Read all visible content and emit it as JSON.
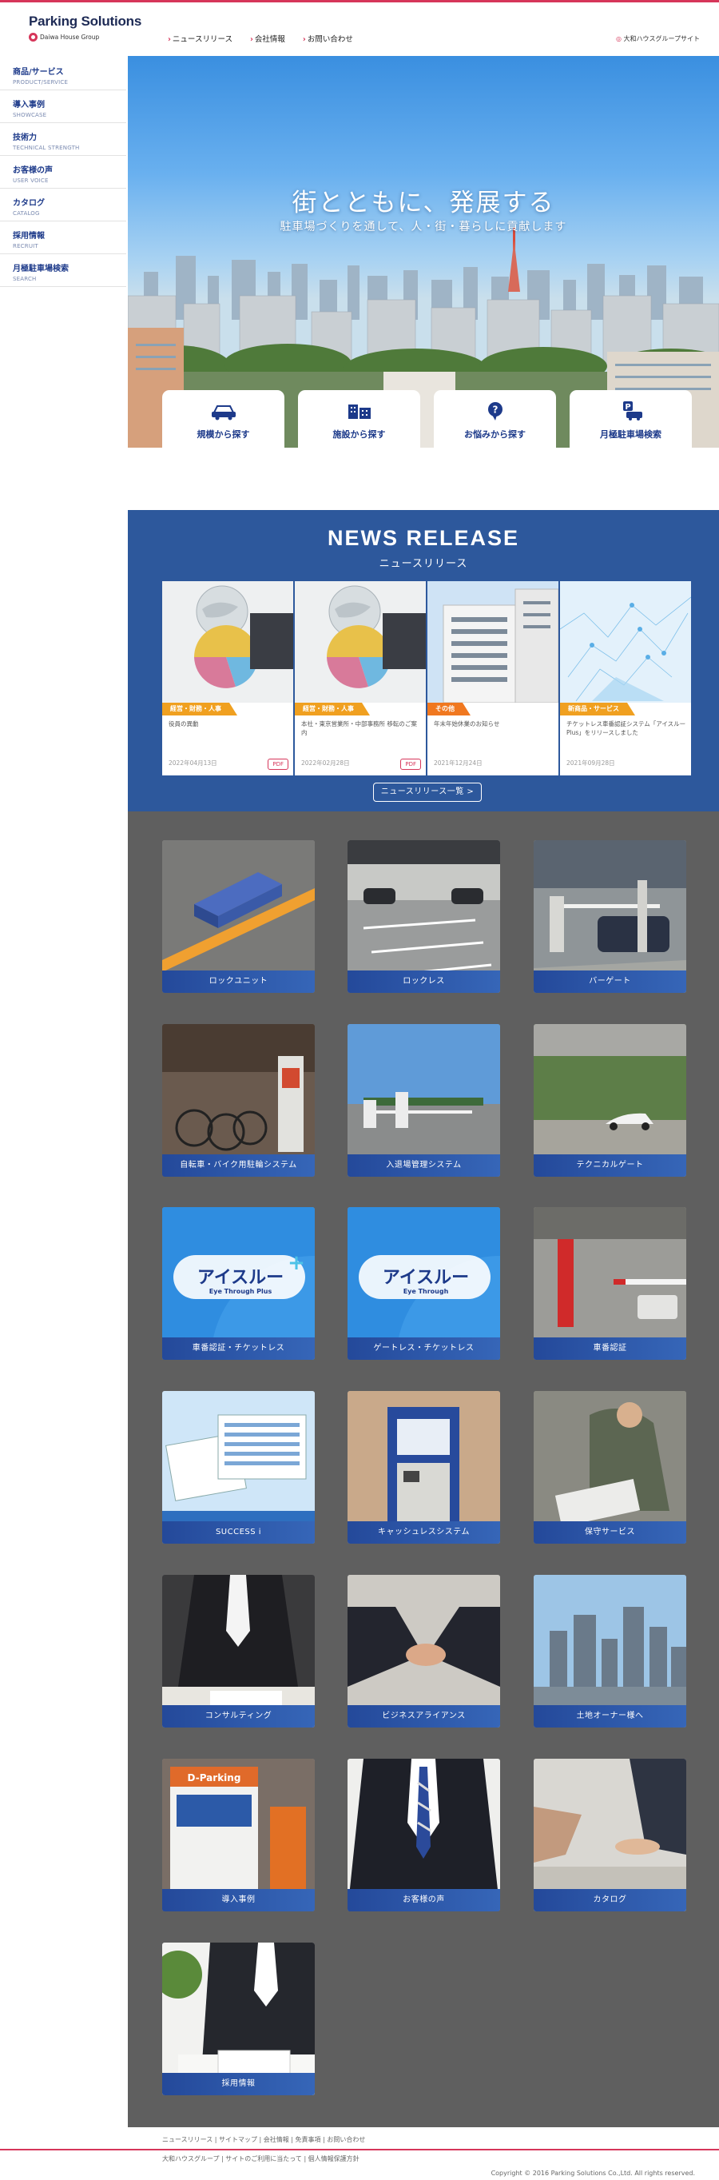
{
  "header": {
    "logo_title": "Parking Solutions",
    "logo_group": "Daiwa House Group",
    "nav": [
      "ニュースリリース",
      "会社情報",
      "お問い合わせ"
    ],
    "group_link": "大和ハウスグループサイト"
  },
  "sidebar": {
    "items": [
      {
        "jp": "商品/サービス",
        "en": "PRODUCT/SERVICE"
      },
      {
        "jp": "導入事例",
        "en": "SHOWCASE"
      },
      {
        "jp": "技術力",
        "en": "TECHNICAL STRENGTH"
      },
      {
        "jp": "お客様の声",
        "en": "USER VOICE"
      },
      {
        "jp": "カタログ",
        "en": "CATALOG"
      },
      {
        "jp": "採用情報",
        "en": "RECRUIT"
      },
      {
        "jp": "月極駐車場検索",
        "en": "SEARCH"
      }
    ]
  },
  "hero": {
    "title": "街とともに、発展する",
    "subtitle": "駐車場づくりを通して、人・街・暮らしに貢献します",
    "search_buttons": [
      {
        "label": "規模から探す",
        "icon": "car-icon"
      },
      {
        "label": "施設から探す",
        "icon": "building-icon"
      },
      {
        "label": "お悩みから探す",
        "icon": "question-bubble-icon"
      },
      {
        "label": "月極駐車場検索",
        "icon": "parking-car-icon"
      }
    ]
  },
  "news": {
    "title": "NEWS RELEASE",
    "subtitle": "ニュースリリース",
    "more_label": "ニュースリリース一覧 >",
    "items": [
      {
        "category": "経営・財務・人事",
        "category_color": "#f0a020",
        "text": "役員の異動",
        "date": "2022年04月13日",
        "pdf": "PDF"
      },
      {
        "category": "経営・財務・人事",
        "category_color": "#f0a020",
        "text": "本社・東京営業所・中部事務所 移転のご案内",
        "date": "2022年02月28日",
        "pdf": "PDF"
      },
      {
        "category": "その他",
        "category_color": "#f07820",
        "text": "年末年始休業のお知らせ",
        "date": "2021年12月24日",
        "pdf": ""
      },
      {
        "category": "新商品・サービス",
        "category_color": "#f0a020",
        "text": "チケットレス車番認証システム「アイスルーPlus」をリリースしました",
        "date": "2021年09月28日",
        "pdf": ""
      }
    ]
  },
  "products": [
    {
      "label": "ロックユニット"
    },
    {
      "label": "ロックレス"
    },
    {
      "label": "バーゲート"
    },
    {
      "label": "自転車・バイク用駐輪システム"
    },
    {
      "label": "入退場管理システム"
    },
    {
      "label": "テクニカルゲート"
    },
    {
      "label": "車番認証・チケットレス",
      "logo_main": "アイスルー",
      "logo_sub": "Eye Through Plus"
    },
    {
      "label": "ゲートレス・チケットレス",
      "logo_main": "アイスルー",
      "logo_sub": "Eye Through"
    },
    {
      "label": "車番認証"
    },
    {
      "label": "SUCCESS i"
    },
    {
      "label": "キャッシュレスシステム"
    },
    {
      "label": "保守サービス"
    },
    {
      "label": "コンサルティング"
    },
    {
      "label": "ビジネスアライアンス"
    },
    {
      "label": "土地オーナー様へ"
    },
    {
      "label": "導入事例",
      "sign_text": "D-Parking"
    },
    {
      "label": "お客様の声"
    },
    {
      "label": "カタログ"
    },
    {
      "label": "採用情報"
    }
  ],
  "footer": {
    "links1": "ニュースリリース | サイトマップ | 会社情報 | 免責事項 | お問い合わせ",
    "links2": "大和ハウスグループ | サイトのご利用に当たって | 個人情報保護方針",
    "copyright": "Copyright © 2016 Parking Solutions Co.,Ltd. All rights reserved."
  }
}
